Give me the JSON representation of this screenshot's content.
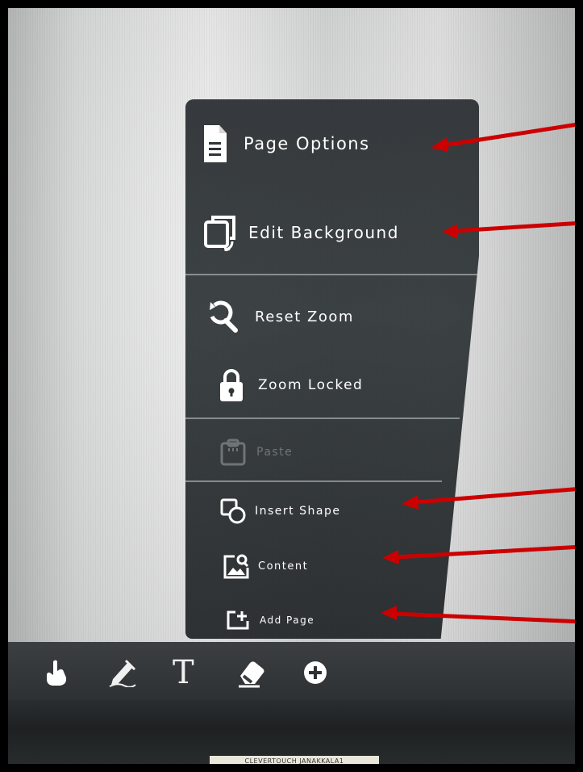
{
  "menu": {
    "items": [
      {
        "label": "Page Options",
        "icon": "document-icon",
        "enabled": true
      },
      {
        "label": "Edit Background",
        "icon": "layers-swap-icon",
        "enabled": true
      },
      {
        "label": "Reset Zoom",
        "icon": "zoom-reset-icon",
        "enabled": true
      },
      {
        "label": "Zoom Locked",
        "icon": "lock-icon",
        "enabled": true
      },
      {
        "label": "Paste",
        "icon": "clipboard-icon",
        "enabled": false
      },
      {
        "label": "Insert Shape",
        "icon": "shapes-icon",
        "enabled": true
      },
      {
        "label": "Content",
        "icon": "image-search-icon",
        "enabled": true
      },
      {
        "label": "Add Page",
        "icon": "add-page-icon",
        "enabled": true
      }
    ]
  },
  "toolbar": {
    "tools": [
      "hand-icon",
      "pen-icon",
      "text-icon",
      "eraser-icon",
      "add-icon"
    ],
    "text_tool_label": "T"
  },
  "device": {
    "sticker": "CLEVERTOUCH JANAKKALA1"
  },
  "colors": {
    "menu_bg": "#2f3437",
    "annotation_arrow": "#cc0000",
    "disabled_text": "#6e7477"
  }
}
